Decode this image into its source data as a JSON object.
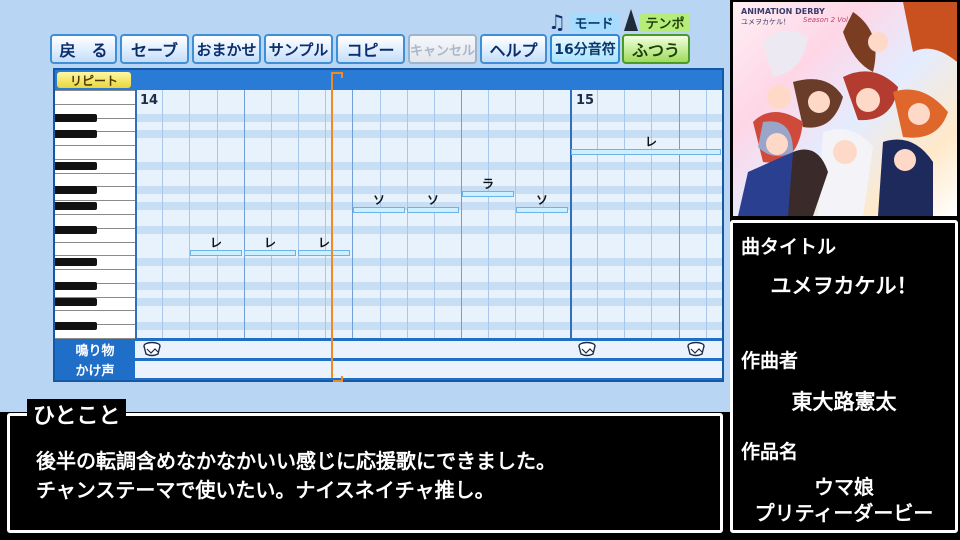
{
  "toolbar": {
    "buttons": [
      "戻　る",
      "セーブ",
      "おまかせ",
      "サンプル",
      "コピー",
      "キャンセル",
      "ヘルプ"
    ],
    "mode_label": "モード",
    "tempo_label": "テンポ",
    "mode_value": "16分音符",
    "tempo_value": "ふつう"
  },
  "editor": {
    "repeat_label": "リピート",
    "measure_a": "14",
    "measure_b": "15",
    "notes": [
      {
        "label": "レ"
      },
      {
        "label": "レ"
      },
      {
        "label": "レ"
      },
      {
        "label": "ソ"
      },
      {
        "label": "ソ"
      },
      {
        "label": "ラ"
      },
      {
        "label": "ソ"
      },
      {
        "label": "レ"
      }
    ],
    "percussion": {
      "row1": "鳴り物",
      "row2": "かけ声"
    }
  },
  "comment": {
    "title": "ひとこと",
    "line1": "後半の転調含めなかなかいい感じに応援歌にできました。",
    "line2": "チャンステーマで使いたい。ナイスネイチャ推し。"
  },
  "jacket": {
    "line1": "ANIMATION DERBY",
    "line2": "Season 2 Vol.1",
    "line3": "ユメヲカケル！"
  },
  "info": {
    "title_head": "曲タイトル",
    "title_value": "ユメヲカケル！",
    "composer_head": "作曲者",
    "composer_value": "東大路憲太",
    "work_head": "作品名",
    "work_value_1": "ウマ娘",
    "work_value_2": "プリティーダービー"
  },
  "colors": {
    "accent": "#1f6fc9",
    "playhead": "#f08a24",
    "note": "#ccf0ff"
  }
}
